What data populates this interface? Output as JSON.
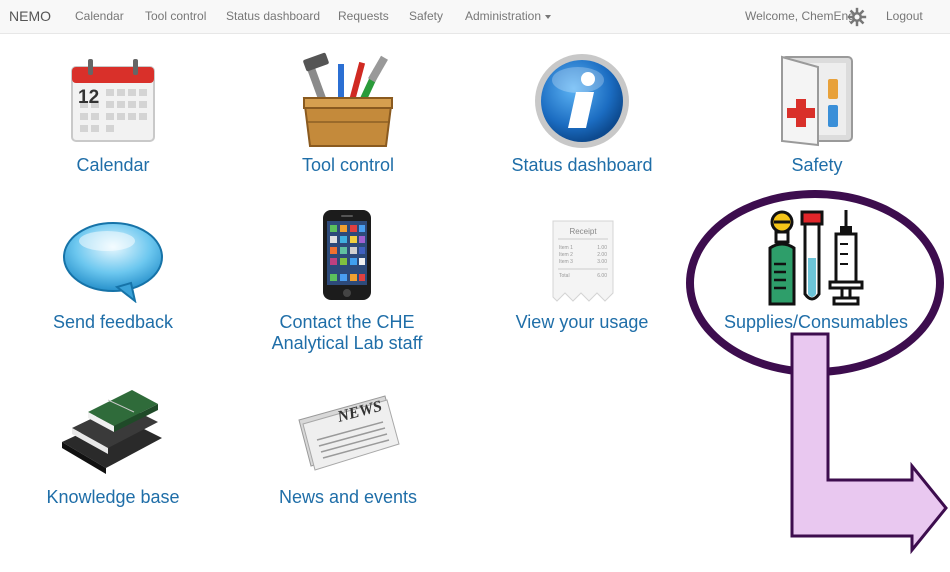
{
  "navbar": {
    "brand": "NEMO",
    "items": [
      {
        "label": "Calendar"
      },
      {
        "label": "Tool control"
      },
      {
        "label": "Status dashboard"
      },
      {
        "label": "Requests"
      },
      {
        "label": "Safety"
      },
      {
        "label": "Administration"
      }
    ],
    "welcome": "Welcome, ChemEng",
    "logout": "Logout"
  },
  "tiles": [
    {
      "label": "Calendar",
      "icon": "calendar-icon"
    },
    {
      "label": "Tool control",
      "icon": "toolbox-icon"
    },
    {
      "label": "Status dashboard",
      "icon": "info-icon"
    },
    {
      "label": "Safety",
      "icon": "first-aid-cabinet-icon"
    },
    {
      "label": "Send feedback",
      "icon": "speech-bubble-icon"
    },
    {
      "label_line1": "Contact the CHE",
      "label_line2": "Analytical Lab staff",
      "icon": "smartphone-icon"
    },
    {
      "label": "View your usage",
      "icon": "receipt-icon"
    },
    {
      "label": "Supplies/Consumables",
      "icon": "lab-supplies-icon"
    },
    {
      "label": "Knowledge base",
      "icon": "books-icon"
    },
    {
      "label": "News and events",
      "icon": "newspaper-icon"
    }
  ],
  "receipt": {
    "title": "Receipt",
    "rows": [
      {
        "name": "Item 1",
        "value": "1.00"
      },
      {
        "name": "Item 2",
        "value": "2.00"
      },
      {
        "name": "Item 3",
        "value": "3.00"
      },
      {
        "name": "Total",
        "value": "6.00"
      }
    ]
  },
  "calendar_day": "12",
  "newspaper_masthead": "NEWS",
  "colors": {
    "link": "#1f6ea8",
    "highlight_ring": "#3d0d4e",
    "arrow_fill": "#e9c8f0",
    "arrow_stroke": "#3d0d4e"
  }
}
